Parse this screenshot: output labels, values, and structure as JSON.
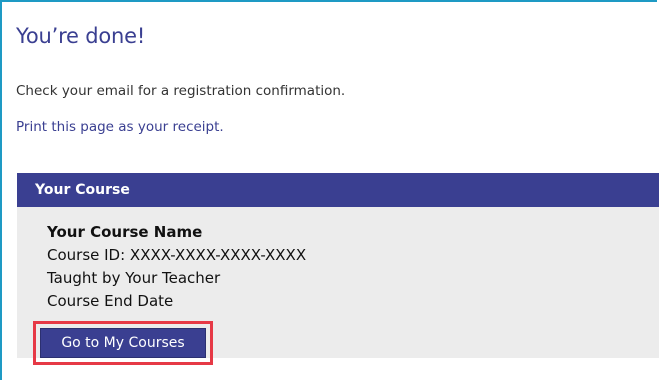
{
  "page": {
    "title": "You’re done!",
    "message": "Check your email for a registration confirmation.",
    "print_link": "Print this page as your receipt."
  },
  "course_panel": {
    "header": "Your Course",
    "course_name": "Your Course Name",
    "course_id": "Course ID: XXXX-XXXX-XXXX-XXXX",
    "teacher": "Taught by Your Teacher",
    "end_date": "Course End Date",
    "button_label": "Go to My Courses"
  },
  "colors": {
    "brand": "#3a3f91",
    "frame_border": "#1e9ac4",
    "highlight": "#e63946",
    "panel_bg": "#ececec"
  }
}
